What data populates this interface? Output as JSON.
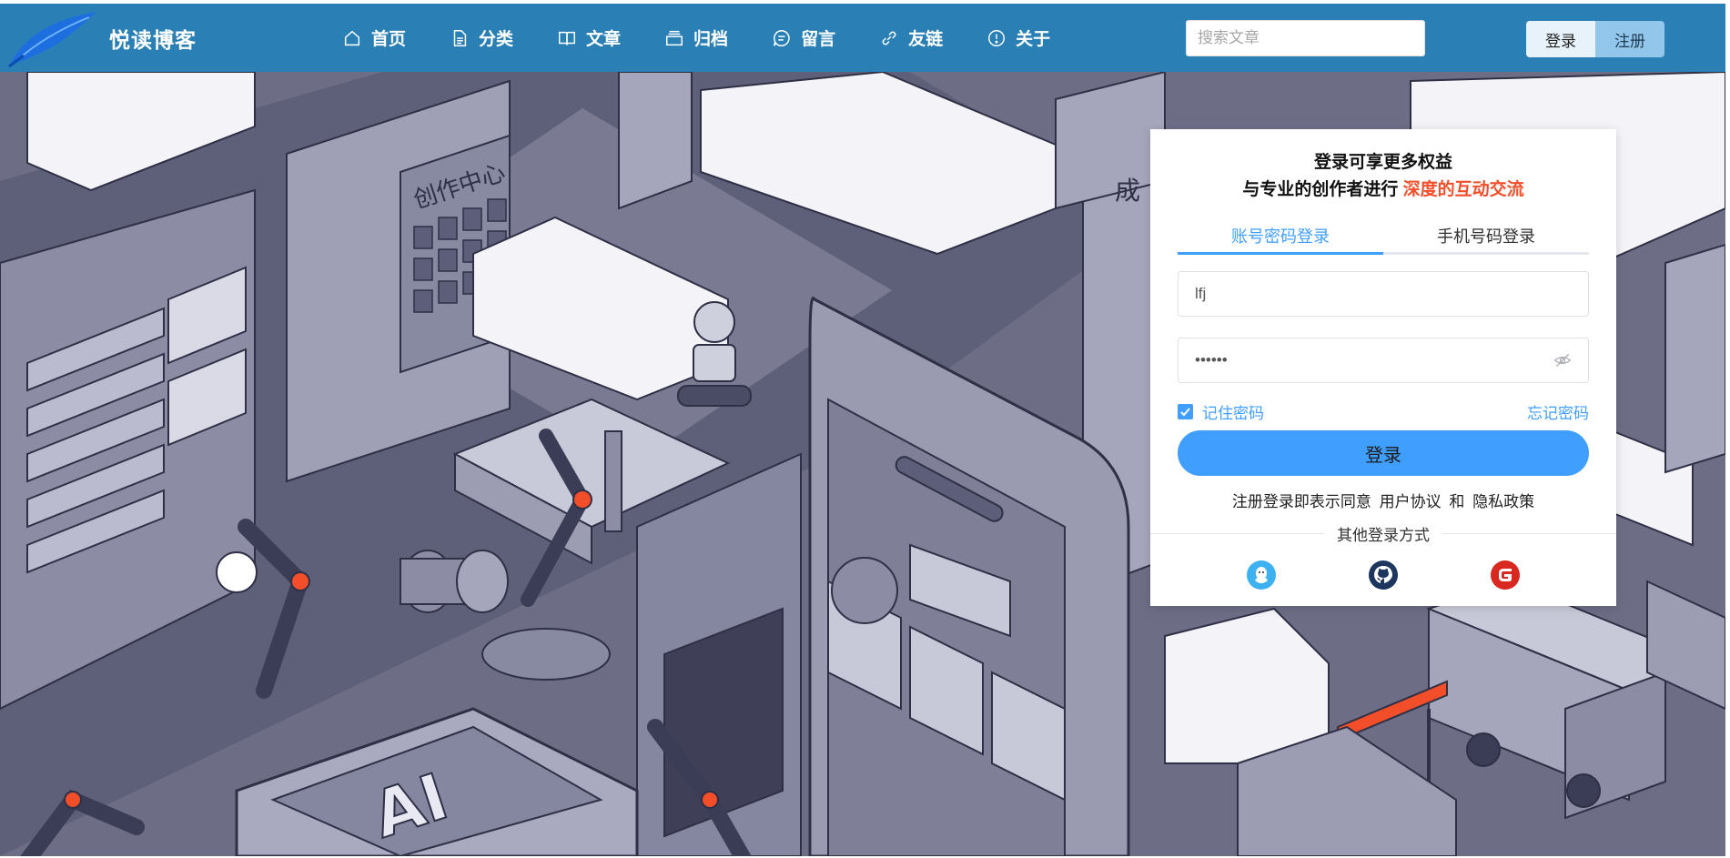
{
  "header": {
    "site_name": "悦读博客",
    "nav": [
      {
        "label": "首页",
        "icon": "home-icon"
      },
      {
        "label": "分类",
        "icon": "document-icon"
      },
      {
        "label": "文章",
        "icon": "book-icon"
      },
      {
        "label": "归档",
        "icon": "archive-icon"
      },
      {
        "label": "留言",
        "icon": "message-icon"
      },
      {
        "label": "友链",
        "icon": "link-icon"
      },
      {
        "label": "关于",
        "icon": "info-icon"
      }
    ],
    "search_placeholder": "搜索文章",
    "login_label": "登录",
    "register_label": "注册"
  },
  "background": {
    "center_sign": "创作中心",
    "ai_sign": "AI",
    "side_sign": "成"
  },
  "login_card": {
    "title": "登录可享更多权益",
    "subtitle_prefix": "与专业的创作者进行",
    "subtitle_highlight": "深度的互动交流",
    "tabs": [
      "账号密码登录",
      "手机号码登录"
    ],
    "active_tab": 0,
    "username_value": "lfj",
    "password_value": "••••••",
    "remember_label": "记住密码",
    "remember_checked": true,
    "forgot_label": "忘记密码",
    "submit_label": "登录",
    "agreement": {
      "prefix": "注册登录即表示同意",
      "user_agreement": "用户协议",
      "and": "和",
      "privacy": "隐私政策"
    },
    "other_label": "其他登录方式",
    "social_icons": [
      "qq-icon",
      "github-icon",
      "gitee-icon"
    ]
  },
  "colors": {
    "header": "#2a80b5",
    "primary": "#409eff",
    "highlight": "#f24e2a"
  }
}
